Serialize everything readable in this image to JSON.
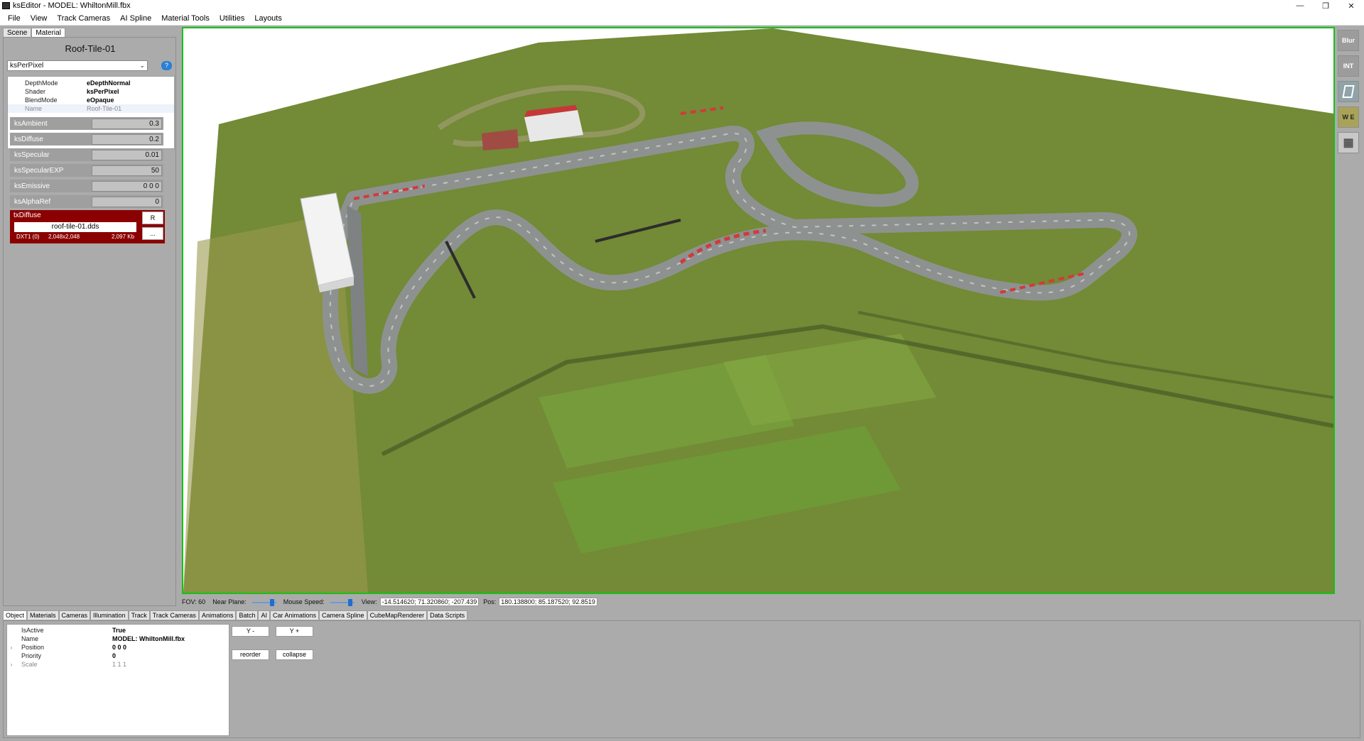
{
  "window": {
    "title": "ksEditor - MODEL: WhiltonMill.fbx",
    "controls": [
      "—",
      "❐",
      "✕"
    ]
  },
  "menu": [
    "File",
    "View",
    "Track Cameras",
    "AI Spline",
    "Material Tools",
    "Utilities",
    "Layouts"
  ],
  "left_tabs": [
    "Scene",
    "Material"
  ],
  "material": {
    "title": "Roof-Tile-01",
    "shader_select": "ksPerPixel",
    "properties": [
      {
        "name": "DepthMode",
        "value": "eDepthNormal"
      },
      {
        "name": "Shader",
        "value": "ksPerPixel"
      },
      {
        "name": "BlendMode",
        "value": "eOpaque"
      },
      {
        "name": "Name",
        "value": "Roof-Tile-01"
      }
    ],
    "params": [
      {
        "label": "ksAmbient",
        "value": "0.3"
      },
      {
        "label": "ksDiffuse",
        "value": "0.2"
      },
      {
        "label": "ksSpecular",
        "value": "0.01"
      },
      {
        "label": "ksSpecularEXP",
        "value": "50"
      },
      {
        "label": "ksEmissive",
        "value": "0 0 0"
      },
      {
        "label": "ksAlphaRef",
        "value": "0"
      }
    ],
    "texture": {
      "label": "txDiffuse",
      "file": "roof-tile-01.dds",
      "format": "DXT1 (0)",
      "dimensions": "2,048x2,048",
      "size": "2,097 Kb",
      "reload_label": "R",
      "browse_label": "..."
    }
  },
  "side_tools": [
    "Blur",
    "INT",
    "",
    "W E",
    ""
  ],
  "status": {
    "fov": "FOV: 60",
    "near_plane_label": "Near Plane:",
    "mouse_speed_label": "Mouse Speed:",
    "view_label": "View:",
    "view_value": "-14.514620; 71.320860; -207.439",
    "pos_label": "Pos:",
    "pos_value": "180.138800; 85.187520; 92.8519"
  },
  "bottom_tabs": [
    "Object",
    "Materials",
    "Cameras",
    "Illumination",
    "Track",
    "Track Cameras",
    "Animations",
    "Batch",
    "AI",
    "Car Animations",
    "Camera Spline",
    "CubeMapRenderer",
    "Data Scripts"
  ],
  "object_props": [
    {
      "name": "IsActive",
      "value": "True",
      "expander": ""
    },
    {
      "name": "Name",
      "value": "MODEL: WhiltonMill.fbx",
      "expander": ""
    },
    {
      "name": "Position",
      "value": "0 0 0",
      "expander": "›"
    },
    {
      "name": "Priority",
      "value": "0",
      "expander": ""
    },
    {
      "name": "Scale",
      "value": "1 1 1",
      "expander": "›"
    }
  ],
  "bottom_buttons": {
    "y_minus": "Y -",
    "y_plus": "Y +",
    "reorder": "reorder",
    "collapse": "collapse"
  }
}
